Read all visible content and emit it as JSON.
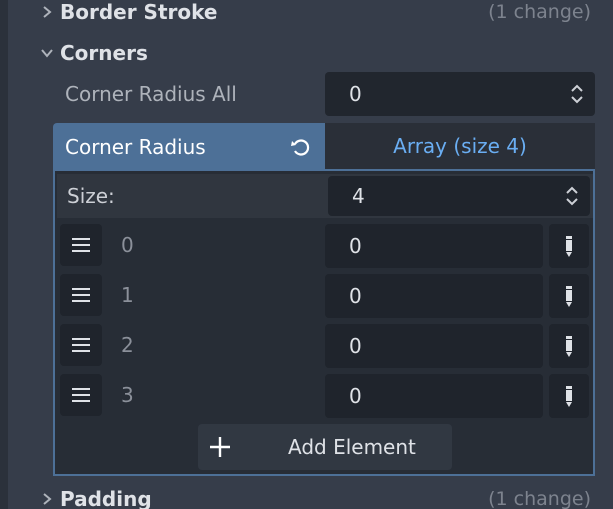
{
  "sections": {
    "border_stroke": {
      "title": "Border Stroke",
      "changes": "(1 change)",
      "icon": "chevron-right-icon"
    },
    "corners": {
      "title": "Corners",
      "icon": "chevron-down-icon"
    },
    "padding": {
      "title": "Padding",
      "changes": "(1 change)",
      "icon": "chevron-right-icon"
    }
  },
  "corner_radius_all": {
    "label": "Corner Radius All",
    "value": "0"
  },
  "array": {
    "label": "Corner Radius",
    "type_label": "Array (size 4)",
    "size_label": "Size:",
    "size_value": "4",
    "elements": [
      {
        "index": "0",
        "value": "0"
      },
      {
        "index": "1",
        "value": "0"
      },
      {
        "index": "2",
        "value": "0"
      },
      {
        "index": "3",
        "value": "0"
      }
    ],
    "add_label": "Add Element"
  },
  "colors": {
    "panel_bg": "#363d4a",
    "accent": "#4d7097",
    "link": "#6aaef3",
    "field_bg": "#21262e"
  }
}
